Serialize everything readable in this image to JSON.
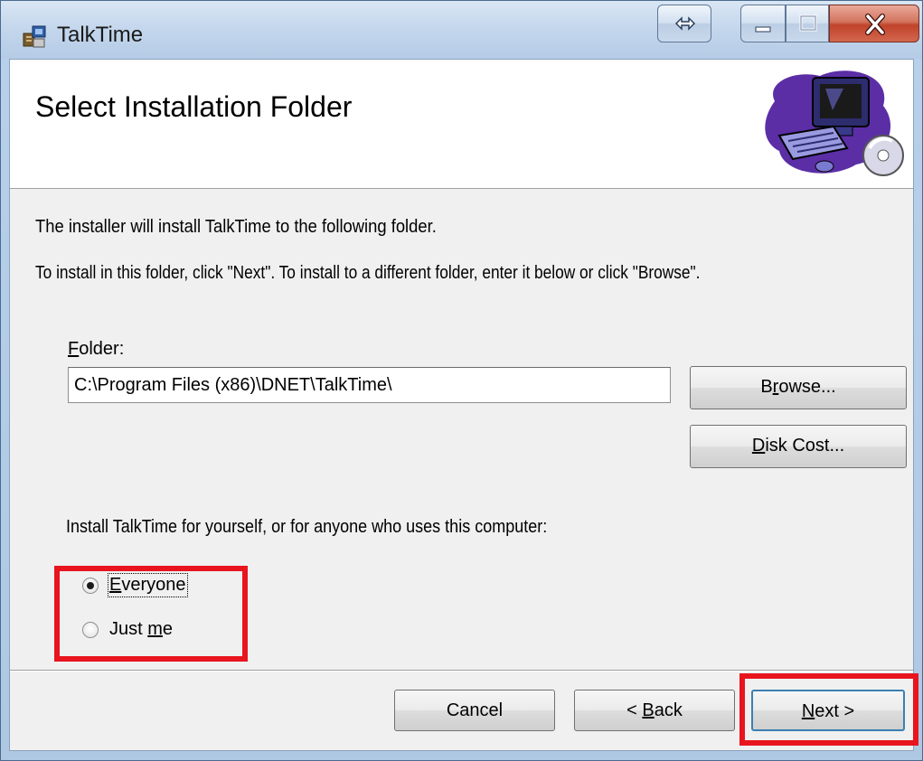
{
  "window": {
    "title": "TalkTime",
    "colors": {
      "highlight": "#e8141e",
      "close_button": "#c0432a"
    }
  },
  "banner": {
    "title": "Select Installation Folder",
    "art": "computer-cd-clipart"
  },
  "body": {
    "intro": "The installer will install TalkTime to the following folder.",
    "instructions": "To install in this folder, click \"Next\". To install to a different folder, enter it below or click \"Browse\"."
  },
  "folder": {
    "label_accel": "F",
    "label_rest": "older:",
    "value": "C:\\Program Files (x86)\\DNET\\TalkTime\\"
  },
  "buttons": {
    "browse": {
      "pre": "B",
      "accel": "r",
      "post": "owse..."
    },
    "disk_cost": {
      "pre": "",
      "accel": "D",
      "post": "isk Cost..."
    },
    "cancel": "Cancel",
    "back": {
      "pre": "< ",
      "accel": "B",
      "post": "ack"
    },
    "next": {
      "pre": "",
      "accel": "N",
      "post": "ext >"
    }
  },
  "install_for": {
    "prompt": "Install TalkTime for yourself, or for anyone who uses this computer:",
    "options": [
      {
        "pre": "",
        "accel": "E",
        "post": "veryone",
        "selected": true
      },
      {
        "pre": "Just ",
        "accel": "m",
        "post": "e",
        "selected": false
      }
    ]
  }
}
